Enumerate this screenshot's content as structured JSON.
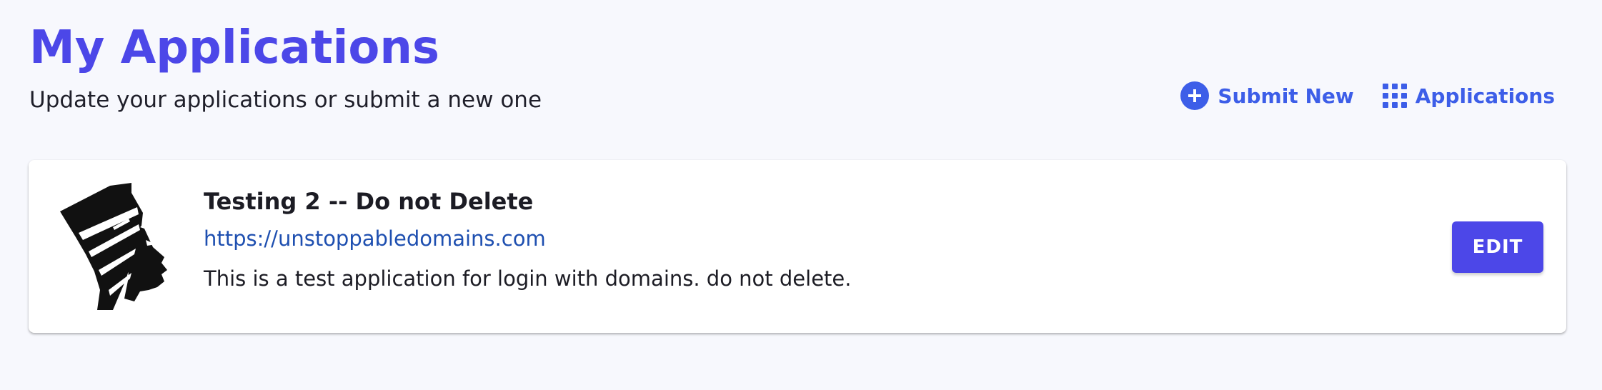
{
  "header": {
    "title": "My Applications",
    "subtitle": "Update your applications or submit a new one",
    "actions": {
      "submit_new": {
        "label": "Submit New",
        "icon": "plus-circle-icon"
      },
      "applications": {
        "label": "Applications",
        "icon": "grid-icon"
      }
    }
  },
  "applications": [
    {
      "name": "Testing 2 -- Do not Delete",
      "url": "https://unstoppabledomains.com",
      "description": "This is a test application for login with domains. do not delete.",
      "logo": "nefertiti-bust-icon",
      "edit_label": "EDIT"
    }
  ],
  "colors": {
    "accent": "#4c47e8",
    "link": "#3d5ee8",
    "background": "#f7f8fd"
  }
}
